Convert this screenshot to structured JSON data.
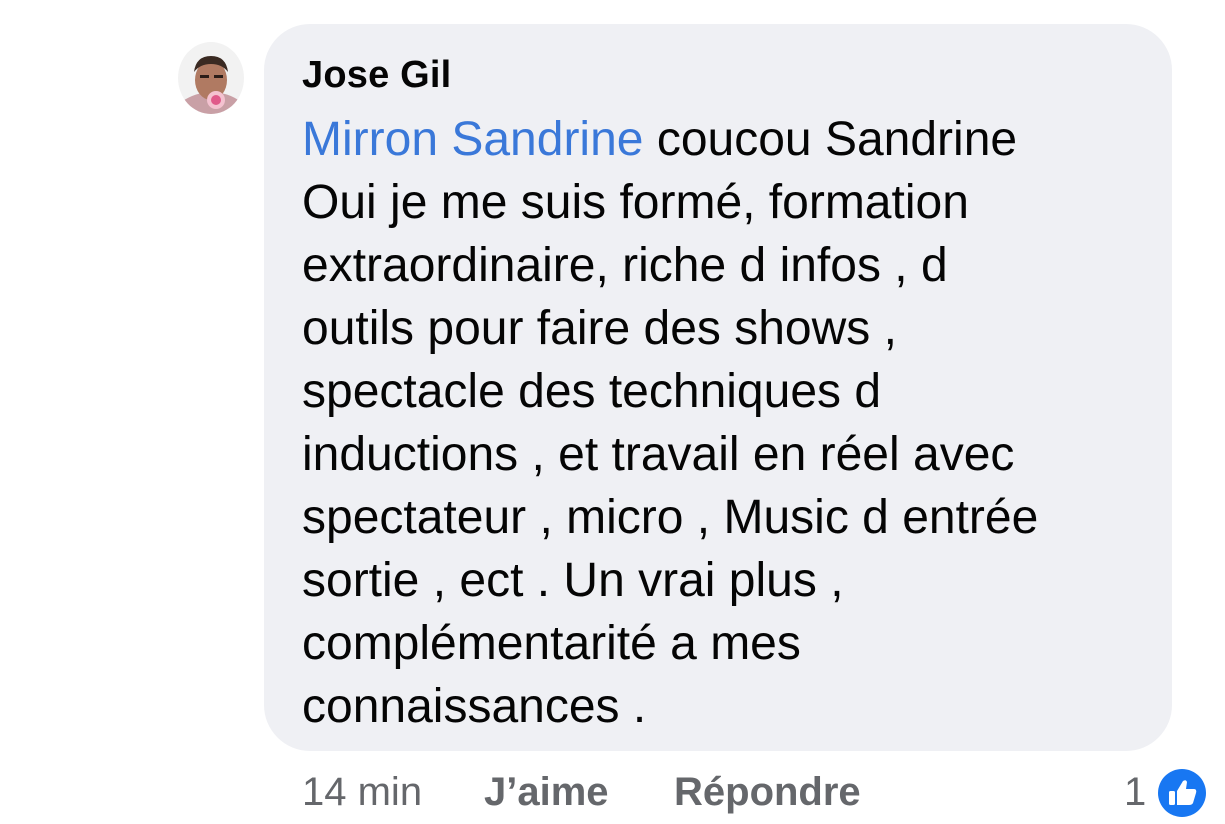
{
  "comment": {
    "author": "Jose Gil",
    "mention": "Mirron Sandrine",
    "first_line_rest": " coucou Sandrine",
    "lines": [
      "Oui je me suis formé, formation",
      "extraordinaire, riche d infos , d",
      "outils pour faire des shows ,",
      "spectacle des techniques d",
      "inductions , et travail en réel avec",
      "spectateur , micro , Music d entrée",
      "sortie , ect . Un vrai plus ,",
      "complémentarité a mes",
      "connaissances ."
    ],
    "avatar_icon": "profile-photo-avatar",
    "colors": {
      "bubble": "#eff0f4",
      "mention": "#3a78d9",
      "text": "#050505",
      "meta": "#65676b",
      "like_blue": "#1877f2"
    }
  },
  "actions": {
    "timestamp": "14 min",
    "like_label": "J’aime",
    "reply_label": "Répondre"
  },
  "reactions": {
    "count": "1",
    "icon": "thumbs-up-icon"
  }
}
